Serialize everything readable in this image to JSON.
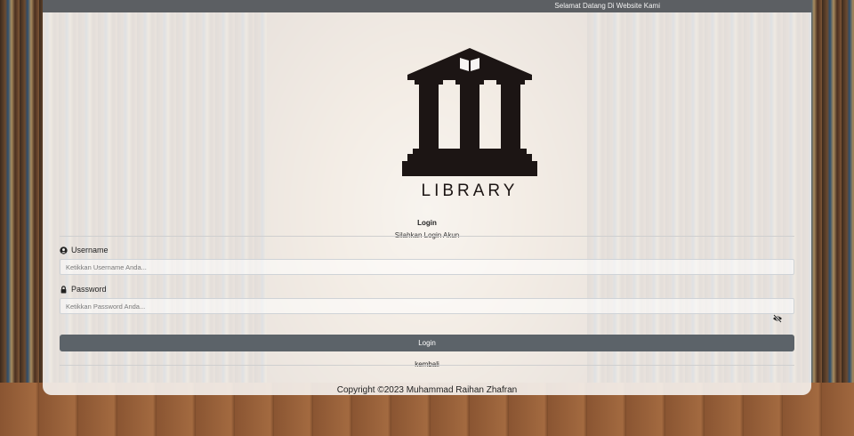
{
  "topbar": {
    "welcome_text": "Selamat Datang Di Website Kami"
  },
  "logo": {
    "text": "LIBRARY",
    "icon": "library-building-icon"
  },
  "login": {
    "title": "Login",
    "subtitle": "Silahkan Login Akun",
    "username_label": "Username",
    "username_placeholder": "Ketikkan Username Anda...",
    "password_label": "Password",
    "password_placeholder": "Ketikkan Password Anda...",
    "submit_label": "Login",
    "back_label": "kembali"
  },
  "footer": {
    "copyright": "Copyright ©2023 Muhammad Raihan Zhafran"
  },
  "colors": {
    "button": "#5c6369",
    "topbar": "#5c5f63",
    "logo": "#1c1514"
  }
}
